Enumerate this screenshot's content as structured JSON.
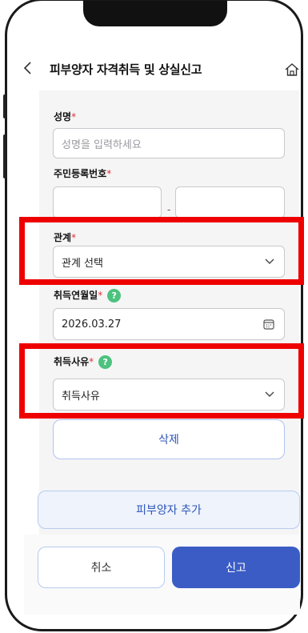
{
  "header": {
    "title": "피부양자 자격취득 및 상실신고",
    "back_icon": "chevron-left-icon",
    "home_icon": "home-icon"
  },
  "form": {
    "name": {
      "label": "성명",
      "required_mark": "*",
      "placeholder": "성명을 입력하세요",
      "value": ""
    },
    "resident_number": {
      "label": "주민등록번호",
      "required_mark": "*",
      "separator": "-",
      "front": "",
      "back": ""
    },
    "relation": {
      "label": "관계",
      "required_mark": "*",
      "selected": "관계 선택"
    },
    "acquire_date": {
      "label": "취득연월일",
      "required_mark": "*",
      "help": "?",
      "value": "2026.03.27"
    },
    "acquire_reason": {
      "label": "취득사유",
      "required_mark": "*",
      "help": "?",
      "selected": "취득사유"
    }
  },
  "buttons": {
    "delete": "삭제",
    "add_dependent": "피부양자 추가",
    "cancel": "취소",
    "submit": "신고"
  },
  "colors": {
    "primary": "#3a5cc4",
    "required": "#e0313b",
    "help": "#4cc27e",
    "highlight": "#ee0000"
  }
}
